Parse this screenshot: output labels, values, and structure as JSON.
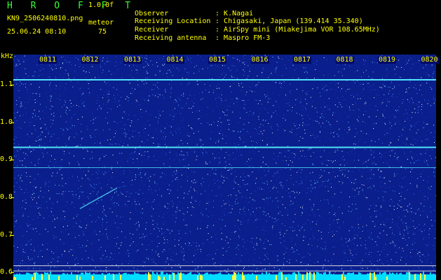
{
  "header": {
    "app_title": "H R O F F T",
    "version": "1.0.0f",
    "filename": "KN9_2506240810.png",
    "datetime": "25.06.24 08:10",
    "mode_label": "meteor",
    "mode_value": "75"
  },
  "metadata": {
    "separator": ":",
    "rows": [
      {
        "key": "Observer",
        "value": "K.Nagai"
      },
      {
        "key": "Receiving Location",
        "value": "Chigasaki, Japan (139.414 35.340)"
      },
      {
        "key": "Receiver",
        "value": "AirSpy mini (Miakejima VOR 108.65MHz)"
      },
      {
        "key": "Receiving antenna",
        "value": "Maspro FM-3"
      }
    ]
  },
  "spectrogram": {
    "unit_label": "kHz",
    "y_ticks": [
      "1.1",
      "1.0",
      "0.9",
      "0.8",
      "0.7",
      "0.6"
    ],
    "y_range": [
      0.58,
      1.18
    ],
    "time_labels": [
      "0811",
      "0812",
      "0813",
      "0814",
      "0815",
      "0816",
      "0817",
      "0818",
      "0819",
      "0820"
    ],
    "carrier_lines_khz": [
      1.113,
      0.933,
      0.879
    ],
    "reference_lines_khz": [
      0.618,
      0.604
    ],
    "colors": {
      "background": "#0a1e8c",
      "carrier": "#55eeff",
      "text": "#ffff00",
      "title": "#33ff33",
      "noise_floor": "#00ddff"
    }
  }
}
